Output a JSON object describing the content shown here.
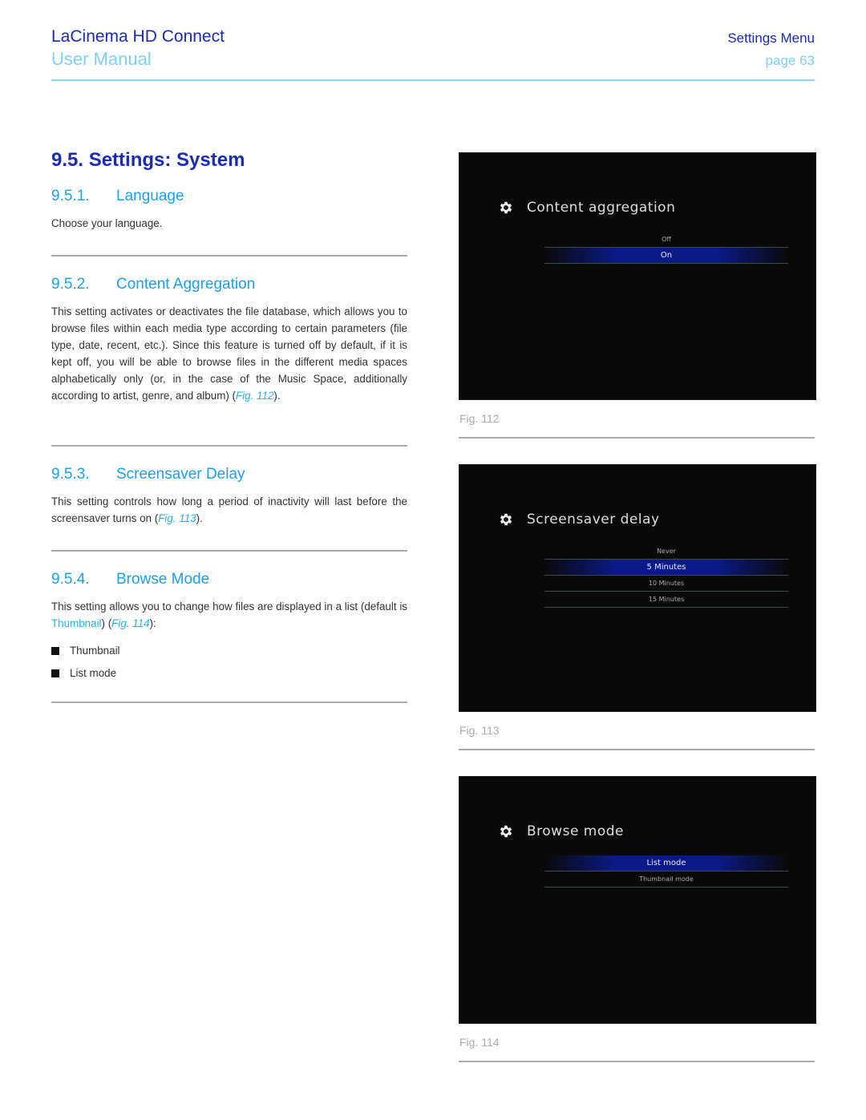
{
  "header": {
    "product": "LaCinema HD Connect",
    "doc_type": "User Manual",
    "section": "Settings Menu",
    "page": "page 63"
  },
  "main": {
    "title": "9.5.  Settings: System",
    "sections": [
      {
        "num": "9.5.1.",
        "title": "Language",
        "body": "Choose your language."
      },
      {
        "num": "9.5.2.",
        "title": "Content Aggregation",
        "body": "This setting activates or deactivates the file database, which allows you to browse files within each media type according to certain parameters (file type, date, recent, etc.).  Since this feature is turned off by default, if it is kept off, you will be able to browse files in the different media spaces alphabetically only (or, in the case of the Music Space, additionally according to artist, genre, and album)",
        "fig_ref": "Fig. 112",
        "open_paren": "(",
        "close": ")."
      },
      {
        "num": "9.5.3.",
        "title": "Screensaver Delay",
        "body": "This setting controls how long a period of inactivity will last before the screensaver turns on",
        "fig_ref": "Fig. 113",
        "open_paren": " (",
        "close": ")."
      },
      {
        "num": "9.5.4.",
        "title": "Browse Mode",
        "body_pre": "This setting allows you to change how files are displayed in a list (default is ",
        "highlight": "Thumbnail",
        "body_mid": ") (",
        "fig_ref": "Fig. 114",
        "close": "):",
        "bullets": [
          "Thumbnail",
          "List mode"
        ]
      }
    ]
  },
  "figures": [
    {
      "label": "Fig. 112",
      "screen_title": "Content aggregation",
      "icon": "gear-icon",
      "options": [
        "Off",
        "On"
      ],
      "selected": "On"
    },
    {
      "label": "Fig. 113",
      "screen_title": "Screensaver delay",
      "icon": "gear-icon",
      "options": [
        "Never",
        "5 Minutes",
        "10 Minutes",
        "15 Minutes"
      ],
      "selected": "5 Minutes"
    },
    {
      "label": "Fig. 114",
      "screen_title": "Browse mode",
      "icon": "gear-icon",
      "options": [
        "List mode",
        "Thumbnail mode"
      ],
      "selected": "List mode"
    }
  ]
}
